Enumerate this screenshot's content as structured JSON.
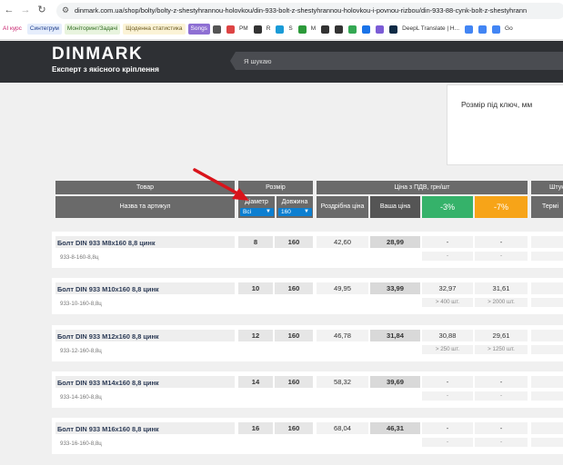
{
  "browser": {
    "url": "dinmark.com.ua/shop/bolty/bolty-z-shestyhrannou-holovkou/din-933-bolt-z-shestyhrannou-holovkou-i-povnou-rizbou/din-933-88-cynk-bolt-z-shestyhrann",
    "bookmarks": [
      {
        "label": "AI курс",
        "color": "#c71d6a",
        "bg": "#fff"
      },
      {
        "label": "Синтегрум",
        "color": "#1a3a8a",
        "bg": "#e6eefc"
      },
      {
        "label": "Моніторинг/Задачі",
        "color": "#2f6b1f",
        "bg": "#e8f4de"
      },
      {
        "label": "Щоденна статистика",
        "color": "#6b5a1f",
        "bg": "#fbf3d6"
      },
      {
        "label": "Songs",
        "color": "#fff",
        "bg": "#8e6fd3"
      }
    ],
    "bookmark_icons": [
      {
        "label": "",
        "color": "#555"
      },
      {
        "label": "PM",
        "color": "#d44"
      },
      {
        "label": "R",
        "color": "#333"
      },
      {
        "label": "S",
        "color": "#1a9bd7"
      },
      {
        "label": "M",
        "color": "#2c9a3a"
      },
      {
        "label": "",
        "color": "#333"
      },
      {
        "label": "",
        "color": "#333"
      },
      {
        "label": "",
        "color": "#34a853"
      },
      {
        "label": "",
        "color": "#1a73e8"
      },
      {
        "label": "",
        "color": "#7b5cd6"
      },
      {
        "label": "DeepL Translate | H...",
        "color": "#0f2b46"
      },
      {
        "label": "",
        "color": "#4285f4"
      },
      {
        "label": "",
        "color": "#4285f4"
      },
      {
        "label": "Go",
        "color": "#4285f4"
      }
    ]
  },
  "site": {
    "logo": "DINMARK",
    "tagline": "Експерт з якісного кріплення",
    "search_placeholder": "Я шукаю"
  },
  "tooltip": {
    "text": "Розмір під ключ, мм"
  },
  "table_header": {
    "product": "Товар",
    "product_sub": "Назва та артикул",
    "size": "Розмір",
    "diameter": "Діаметр",
    "length": "Довжина",
    "diameter_value": "Всі",
    "length_value": "160",
    "price_vat": "Ціна з ПДВ, грн/шт",
    "retail": "Роздрібна ціна",
    "your_price": "Ваша ціна",
    "disc1": "-3%",
    "disc2": "-7%",
    "pieces": "Штук",
    "term": "Термі"
  },
  "rows": [
    {
      "name": "Болт DIN 933 M8x160 8,8 цинк",
      "code": "933-8-160-8,8ц",
      "diam": "8",
      "len": "160",
      "retail": "42,60",
      "your": "28,99",
      "d1": "-",
      "d2": "-",
      "n1": "-",
      "n2": "-"
    },
    {
      "name": "Болт DIN 933 M10x160 8,8 цинк",
      "code": "933-10-160-8,8ц",
      "diam": "10",
      "len": "160",
      "retail": "49,95",
      "your": "33,99",
      "d1": "32,97",
      "d2": "31,61",
      "n1": "> 400 шт.",
      "n2": "> 2000 шт."
    },
    {
      "name": "Болт DIN 933 M12x160 8,8 цинк",
      "code": "933-12-160-8,8ц",
      "diam": "12",
      "len": "160",
      "retail": "46,78",
      "your": "31,84",
      "d1": "30,88",
      "d2": "29,61",
      "n1": "> 250 шт.",
      "n2": "> 1250 шт."
    },
    {
      "name": "Болт DIN 933 M14x160 8,8 цинк",
      "code": "933-14-160-8,8ц",
      "diam": "14",
      "len": "160",
      "retail": "58,32",
      "your": "39,69",
      "d1": "-",
      "d2": "-",
      "n1": "-",
      "n2": "-"
    },
    {
      "name": "Болт DIN 933 M16x160 8,8 цинк",
      "code": "933-16-160-8,8ц",
      "diam": "16",
      "len": "160",
      "retail": "68,04",
      "your": "46,31",
      "d1": "-",
      "d2": "-",
      "n1": "-",
      "n2": "-"
    }
  ]
}
